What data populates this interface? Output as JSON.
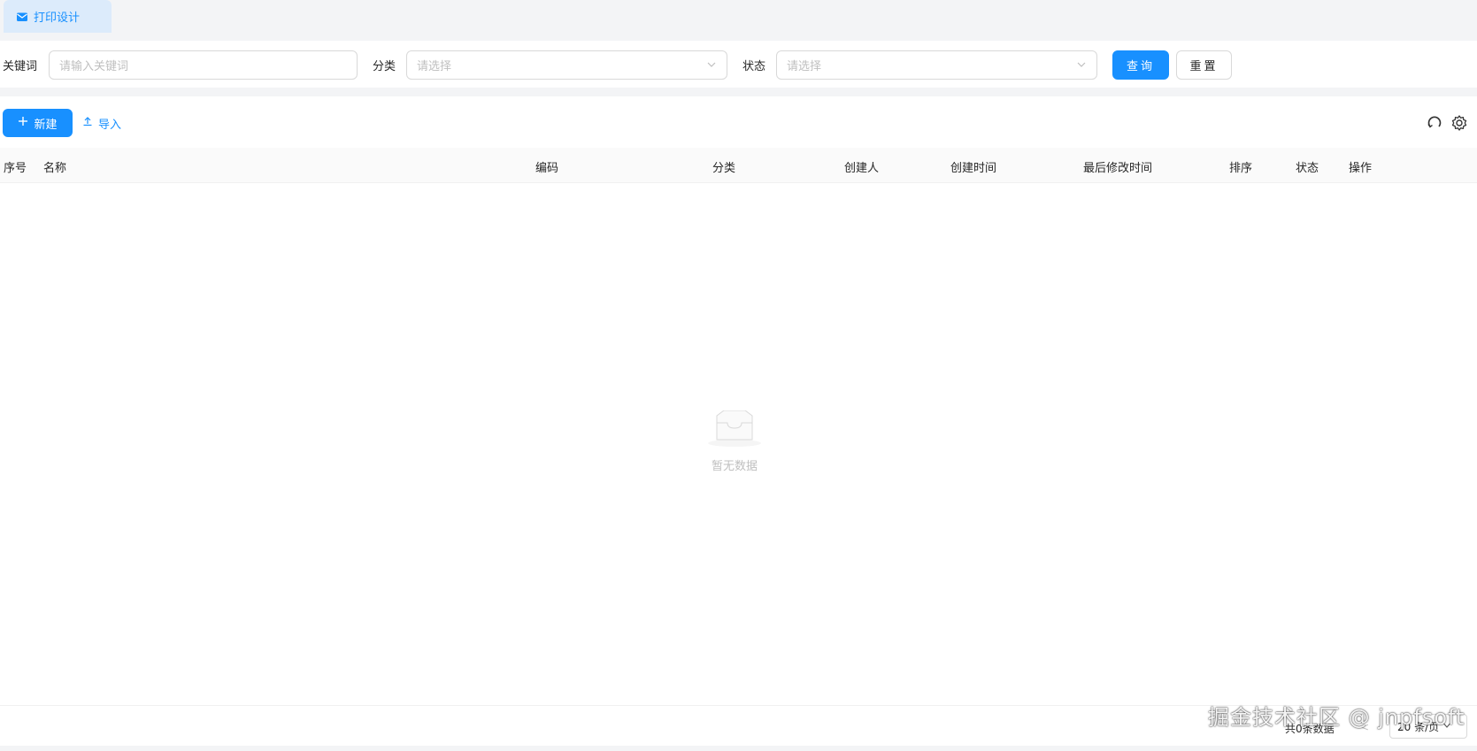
{
  "tab": {
    "label": "打印设计",
    "icon": "mail-icon"
  },
  "search": {
    "keyword_label": "关键词",
    "keyword_placeholder": "请输入关键词",
    "category_label": "分类",
    "category_placeholder": "请选择",
    "status_label": "状态",
    "status_placeholder": "请选择",
    "query_button": "查询",
    "reset_button": "重置"
  },
  "toolbar": {
    "new_button": "新建",
    "import_button": "导入",
    "refresh_icon": "refresh-icon",
    "settings_icon": "gear-icon"
  },
  "table": {
    "columns": [
      "序号",
      "名称",
      "编码",
      "分类",
      "创建人",
      "创建时间",
      "最后修改时间",
      "排序",
      "状态",
      "操作"
    ],
    "empty_text": "暂无数据"
  },
  "pagination": {
    "total_text": "共0条数据",
    "prev_symbol": "<",
    "page_size": "20 条/页"
  },
  "watermark": "掘金技术社区 @ jnpfsoft",
  "colors": {
    "primary": "#1890ff",
    "tab_bg": "#dcebfb"
  }
}
